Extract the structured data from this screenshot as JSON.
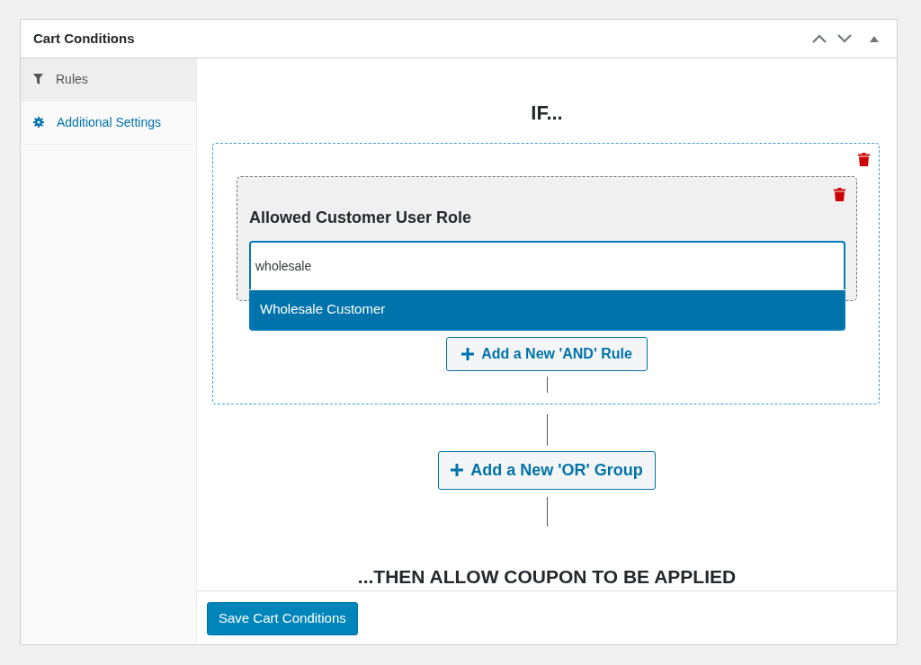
{
  "panel": {
    "title": "Cart Conditions"
  },
  "sidebar": {
    "items": [
      {
        "label": "Rules",
        "selected": true
      },
      {
        "label": "Additional Settings",
        "selected": false
      }
    ]
  },
  "if_label": "IF...",
  "groups": [
    {
      "rules": [
        {
          "title": "Allowed Customer User Role",
          "search": {
            "value": "wholesale"
          },
          "options": [
            {
              "label": "Wholesale Customer",
              "selected": true
            }
          ]
        }
      ],
      "add_rule_button": "Add a New 'AND' Rule"
    }
  ],
  "add_group_button": "Add a New 'OR' Group",
  "then_label": "...THEN ALLOW COUPON TO BE APPLIED",
  "save_button": "Save Cart Conditions"
}
